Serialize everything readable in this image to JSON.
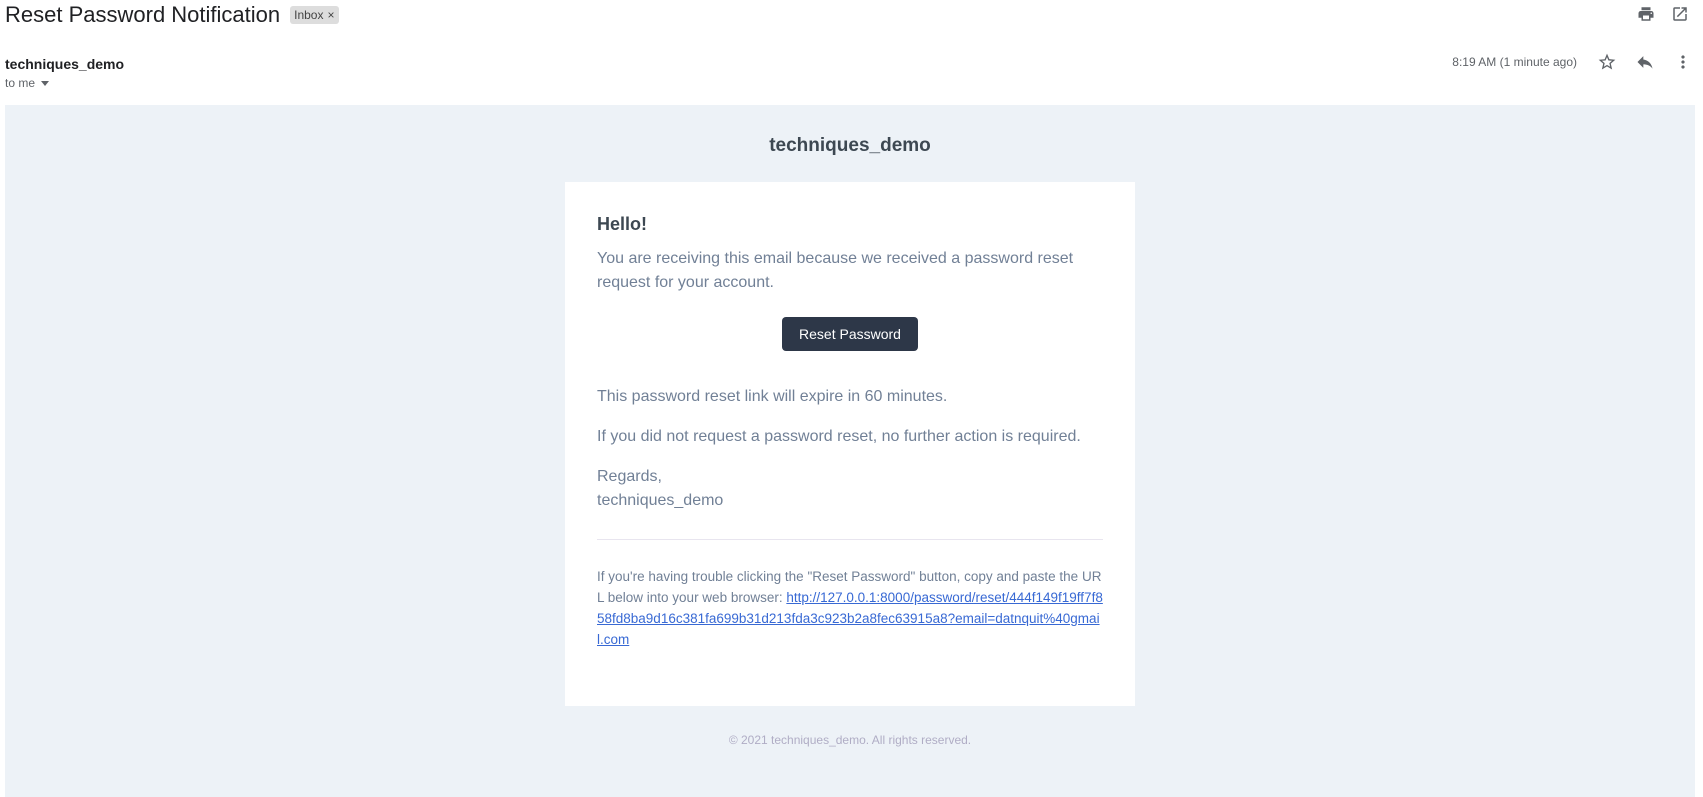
{
  "email": {
    "subject": "Reset Password Notification",
    "label": "Inbox",
    "label_remove": "×",
    "sender": "techniques_demo",
    "recipient": "to me",
    "timestamp": "8:19 AM (1 minute ago)"
  },
  "toolbar": {
    "icons": [
      "print-icon",
      "open-in-new-window-icon",
      "star-icon",
      "reply-icon",
      "more-vert-icon"
    ]
  },
  "content": {
    "brand": "techniques_demo",
    "greeting": "Hello!",
    "intro": "You are receiving this email because we received a password reset request for your account.",
    "button_label": "Reset Password",
    "expiry": "This password reset link will expire in 60 minutes.",
    "no_action": "If you did not request a password reset, no further action is required.",
    "regards": "Regards,",
    "signature": "techniques_demo",
    "subcopy_text": "If you're having trouble clicking the \"Reset Password\" button, copy and paste the URL below into your web browser: ",
    "reset_url": "http://127.0.0.1:8000/password/reset/444f149f19ff7f858fd8ba9d16c381fa699b31d213fda3c923b2a8fec63915a8?email=datnquit%40gmail.com",
    "footer": "© 2021 techniques_demo. All rights reserved."
  },
  "colors": {
    "button_bg": "#2d3748",
    "body_bg": "#edf2f7",
    "link": "#3869d4",
    "text_muted": "#718096"
  }
}
